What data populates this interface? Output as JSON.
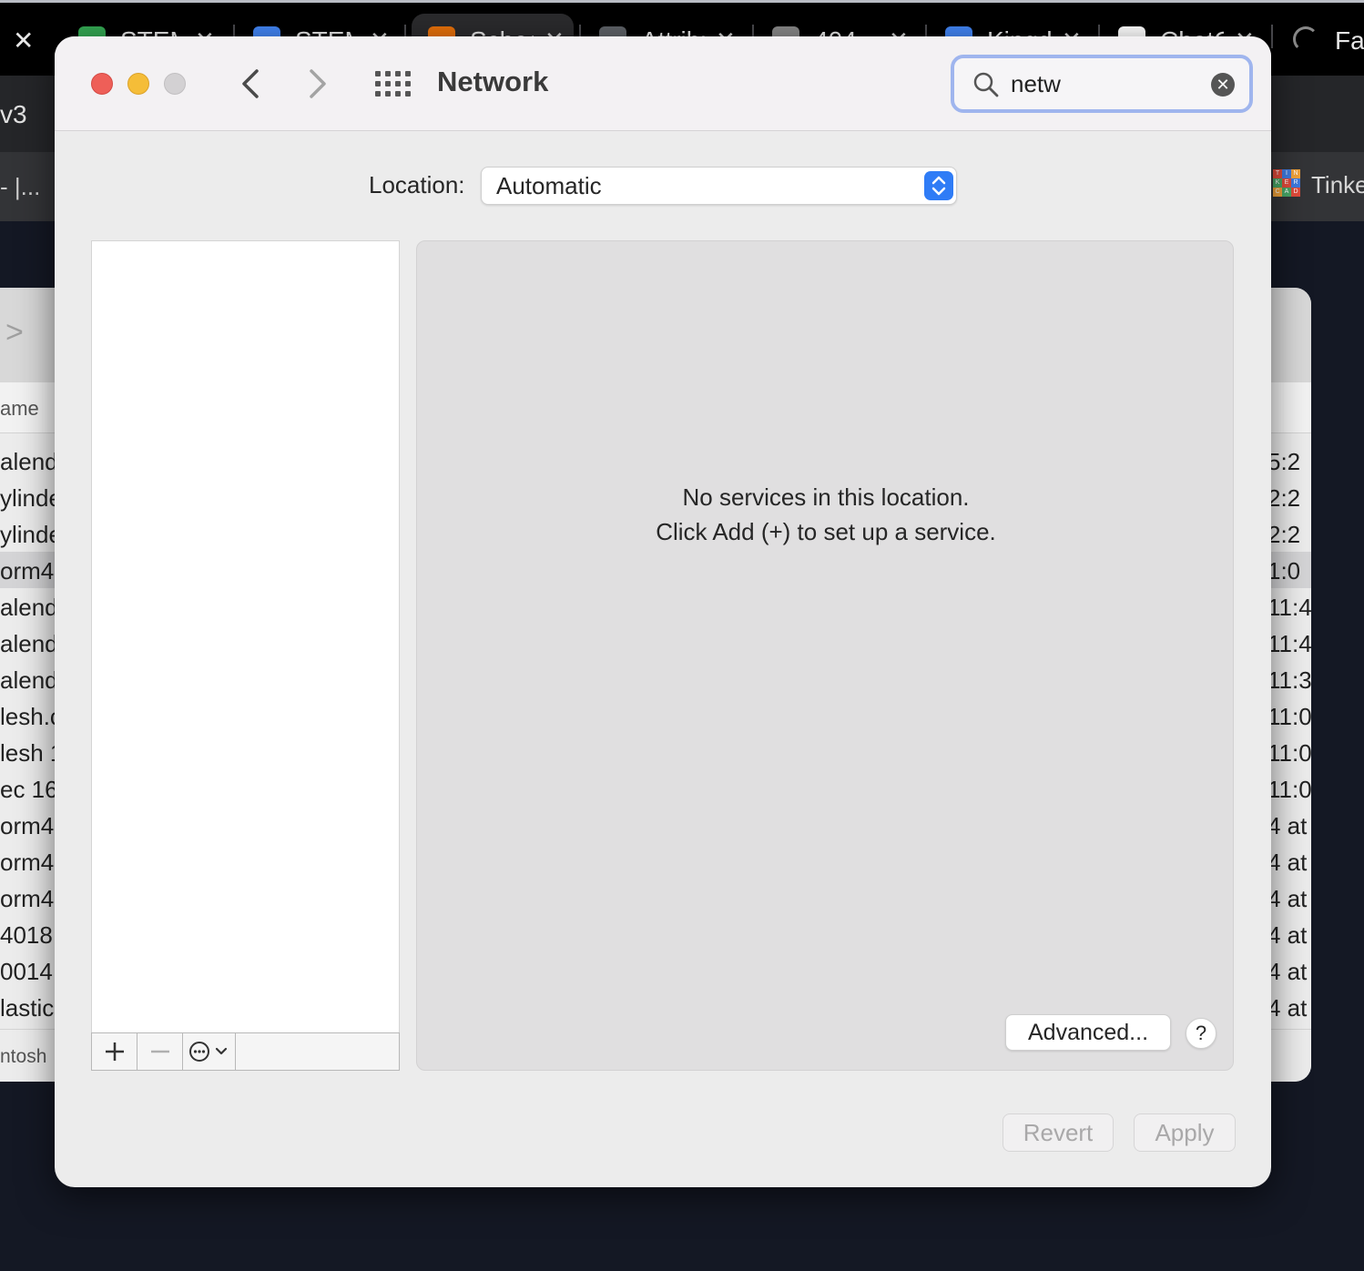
{
  "browser": {
    "tabs": [
      {
        "label": "STEM",
        "color": "#34a853"
      },
      {
        "label": "STEM",
        "color": "#4285f4"
      },
      {
        "label": "Scheduling",
        "color": "#e8710a"
      },
      {
        "label": "Attributions",
        "color": "#5f6368"
      },
      {
        "label": "404",
        "color": "#888888"
      },
      {
        "label": "Kingdom",
        "color": "#4285f4"
      },
      {
        "label": "ChatGPT",
        "color": "#ffffff"
      }
    ],
    "close_glyph": "✕",
    "tab_close_glyph": "✕",
    "last_tab_label": "Fac",
    "address_fragment": "v3",
    "bookmark_left": "- |...",
    "bookmark_right": "Tinke",
    "tinkercad_letters": [
      "T",
      "I",
      "N",
      "K",
      "E",
      "R",
      "C",
      "A",
      "D"
    ]
  },
  "finder": {
    "column_name": "ame",
    "rows": [
      {
        "left": "alend",
        "right": "5:2"
      },
      {
        "left": "ylinde",
        "right": "2:2"
      },
      {
        "left": "ylinde",
        "right": "2:2"
      },
      {
        "left": "orm4",
        "right": "1:0"
      },
      {
        "left": "alend",
        "right": "11:4"
      },
      {
        "left": "alend",
        "right": "11:4"
      },
      {
        "left": "alend",
        "right": "11:3"
      },
      {
        "left": "lesh.c",
        "right": "11:0"
      },
      {
        "left": "lesh 1",
        "right": "11:0"
      },
      {
        "left": "ec 16",
        "right": "11:0"
      },
      {
        "left": "orm4",
        "right": "4 at"
      },
      {
        "left": "orm4",
        "right": "4 at"
      },
      {
        "left": "orm4",
        "right": "4 at"
      },
      {
        "left": "4018",
        "right": "4 at"
      },
      {
        "left": "0014",
        "right": "4 at"
      },
      {
        "left": "lastic",
        "right": "4 at"
      }
    ],
    "footer": "ntosh"
  },
  "window": {
    "title": "Network",
    "search_value": "netw",
    "location_label": "Location:",
    "location_value": "Automatic",
    "empty_line1": "No services in this location.",
    "empty_line2": "Click Add (+) to set up a service.",
    "advanced_label": "Advanced...",
    "help_label": "?",
    "revert_label": "Revert",
    "apply_label": "Apply",
    "clear_glyph": "✕"
  }
}
